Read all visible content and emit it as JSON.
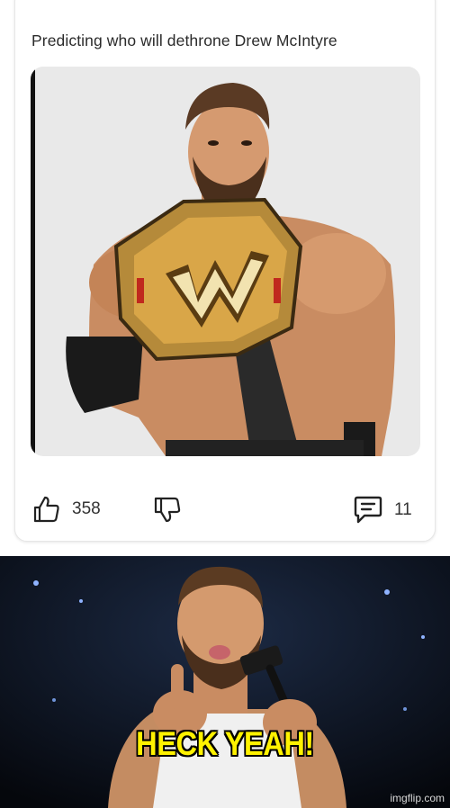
{
  "post": {
    "title": "Predicting who will dethrone Drew McIntyre",
    "image_icon": "wrestler-with-championship-belt",
    "likes": "358",
    "comments": "11"
  },
  "icons": {
    "like": "thumbs-up-icon",
    "dislike": "thumbs-down-icon",
    "comment": "comment-icon"
  },
  "reaction": {
    "caption": "HECK YEAH!",
    "watermark": "imgflip.com",
    "caption_color": "#fff200"
  }
}
